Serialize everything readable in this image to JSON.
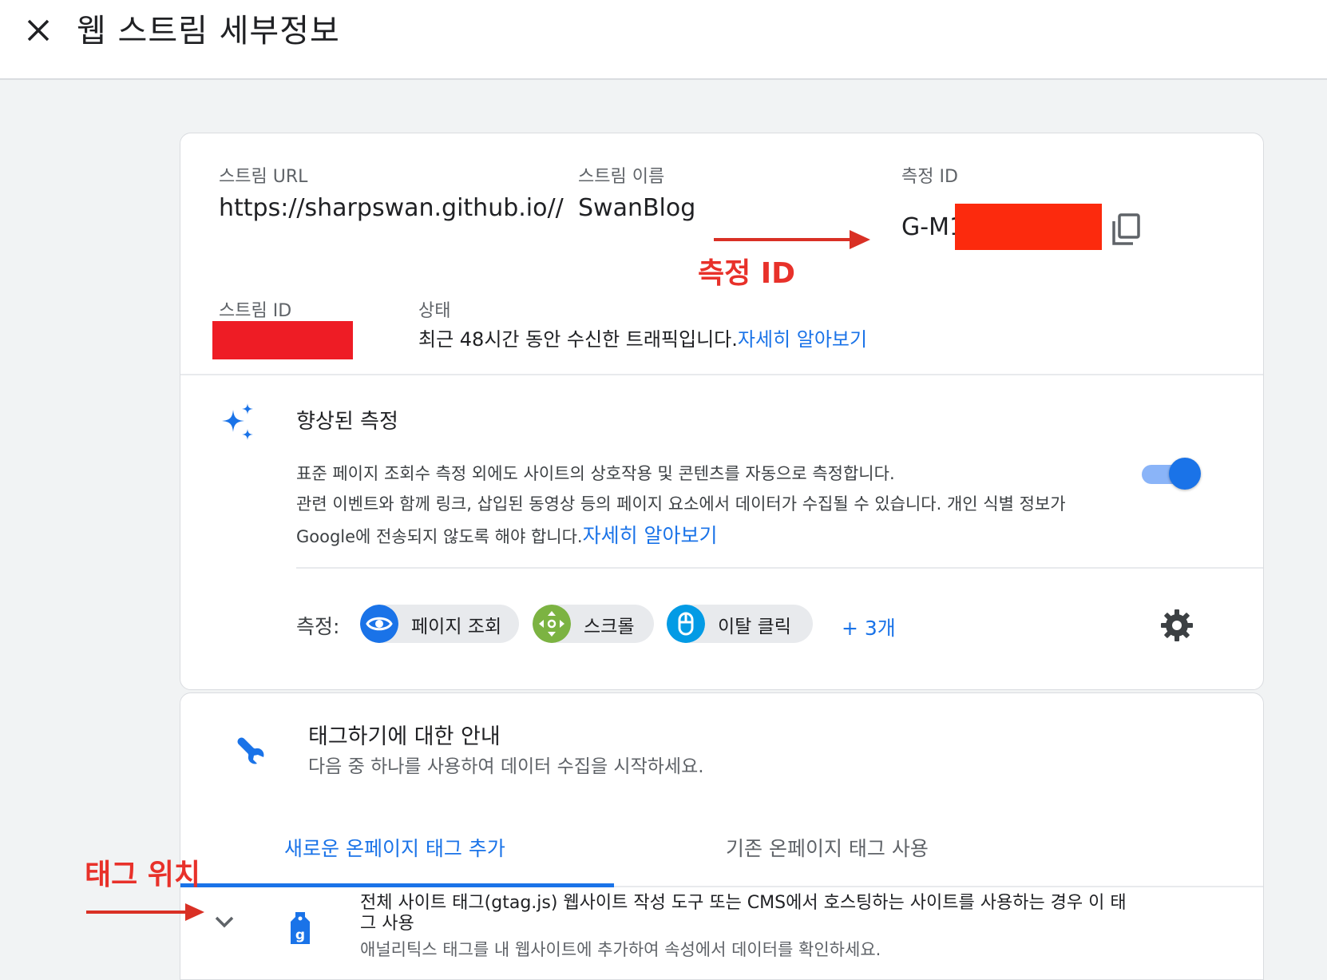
{
  "header": {
    "title": "웹 스트림 세부정보",
    "close_icon": "close-icon"
  },
  "stream": {
    "url_label": "스트림 URL",
    "url_value": "https://sharpswan.github.io//",
    "name_label": "스트림 이름",
    "name_value": "SwanBlog",
    "mid_label": "측정 ID",
    "mid_value": "G-M1",
    "sid_label": "스트림 ID",
    "status_label": "상태",
    "status_text": "최근 48시간 동안 수신한 트래픽입니다.",
    "status_link": "자세히 알아보기"
  },
  "enhanced": {
    "title": "향상된 측정",
    "desc1": "표준 페이지 조회수 측정 외에도 사이트의 상호작용 및 콘텐츠를 자동으로 측정합니다.",
    "desc2": "관련 이벤트와 함께 링크, 삽입된 동영상 등의 페이지 요소에서 데이터가 수집될 수 있습니다. 개인 식별 정보가",
    "desc3": "Google에 전송되지 않도록 해야 합니다.",
    "link": "자세히 알아보기",
    "toggle_on": true,
    "measure_label": "측정:",
    "chips": [
      {
        "label": "페이지 조회",
        "icon": "eye-icon",
        "color": "#1a73e8"
      },
      {
        "label": "스크롤",
        "icon": "scroll-icon",
        "color": "#7cb342"
      },
      {
        "label": "이탈 클릭",
        "icon": "mouse-icon",
        "color": "#039be5"
      }
    ],
    "more": "+ 3개"
  },
  "tagging": {
    "title": "태그하기에 대한 안내",
    "subtitle": "다음 중 하나를 사용하여 데이터 수집을 시작하세요.",
    "tabs": [
      "새로운 온페이지 태그 추가",
      "기존 온페이지 태그 사용"
    ],
    "active_tab": 0,
    "item_title_line1": "전체 사이트 태그(gtag.js) 웹사이트 작성 도구 또는 CMS에서 호스팅하는 사이트를 사용하는 경우 이 태",
    "item_title_line2": "그 사용",
    "item_desc": "애널리틱스 태그를 내 웹사이트에 추가하여 속성에서 데이터를 확인하세요."
  },
  "annotations": {
    "mid": "측정 ID",
    "tag_location": "태그 위치"
  },
  "colors": {
    "accent": "#1a73e8",
    "annotation": "#e8312a",
    "redaction": "#ee1c25"
  }
}
